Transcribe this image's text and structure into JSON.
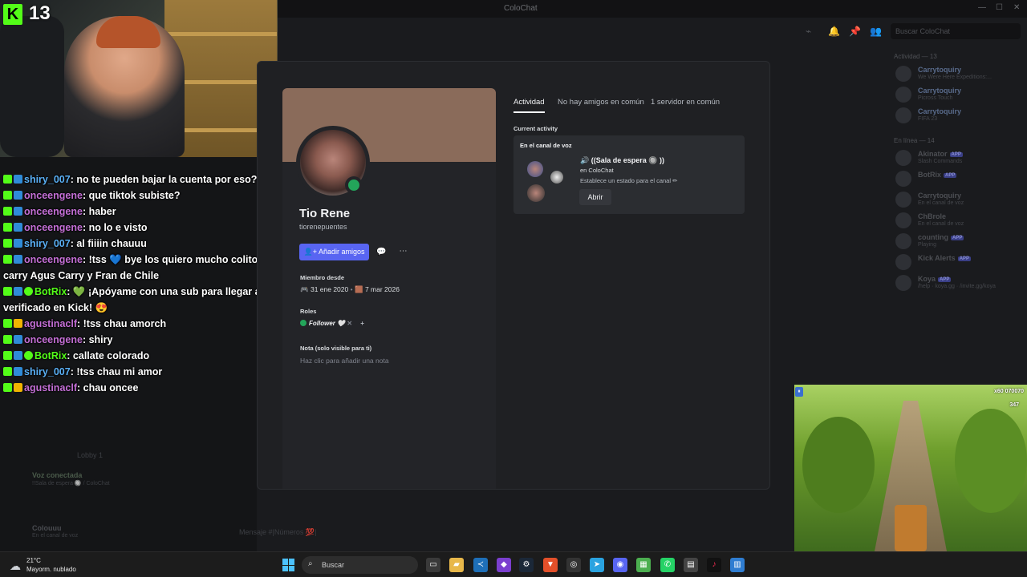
{
  "window": {
    "title": "ColoChat",
    "search_placeholder": "Buscar ColoChat"
  },
  "overlay": {
    "viewer_count": "13",
    "chat": [
      {
        "user": "shiry_007",
        "user_color": "#5ab0f6",
        "badges": [
          "k",
          "b"
        ],
        "text": ": no te pueden bajar la cuenta por eso?"
      },
      {
        "user": "onceengene",
        "user_color": "#c46fd6",
        "badges": [
          "k",
          "b"
        ],
        "text": ": que tiktok subiste?"
      },
      {
        "user": "onceengene",
        "user_color": "#c46fd6",
        "badges": [
          "k",
          "b"
        ],
        "text": ": haber"
      },
      {
        "user": "onceengene",
        "user_color": "#c46fd6",
        "badges": [
          "k",
          "b"
        ],
        "text": ": no lo e visto"
      },
      {
        "user": "shiry_007",
        "user_color": "#5ab0f6",
        "badges": [
          "k",
          "b"
        ],
        "text": ": al fiiiin chauuu"
      },
      {
        "user": "onceengene",
        "user_color": "#c46fd6",
        "badges": [
          "k",
          "b"
        ],
        "text": ": !tss 💙 bye los quiero mucho colito carry Agus Carry y Fran de Chile"
      },
      {
        "user": "BotRix",
        "user_color": "#53fc18",
        "badges": [
          "k",
          "b",
          "g"
        ],
        "text": ": 💚 ¡Apóyame con una sub para llegar al verificado en Kick! 😍"
      },
      {
        "user": "agustinaclf",
        "user_color": "#c46fd6",
        "badges": [
          "k",
          "c"
        ],
        "text": ": !tss chau amorch"
      },
      {
        "user": "onceengene",
        "user_color": "#c46fd6",
        "badges": [
          "k",
          "b"
        ],
        "text": ": shiry"
      },
      {
        "user": "BotRix",
        "user_color": "#53fc18",
        "badges": [
          "k",
          "b",
          "g"
        ],
        "text": ": callate colorado"
      },
      {
        "user": "shiry_007",
        "user_color": "#5ab0f6",
        "badges": [
          "k",
          "b"
        ],
        "text": ": !tss chau mi amor"
      },
      {
        "user": "agustinaclf",
        "user_color": "#c46fd6",
        "badges": [
          "k",
          "c"
        ],
        "text": ": chau oncee"
      }
    ]
  },
  "left_panel": {
    "voice_connected": "Voz conectada",
    "voice_channel": "!!Sala de espera 🔘 / ColoChat",
    "lobby": "Lobby 1",
    "user_name": "Colouuu",
    "user_status": "En el canal de voz",
    "message_placeholder": "Mensaje #|Números 💯|"
  },
  "profile": {
    "display_name": "Tio Rene",
    "username": "tiorenepuentes",
    "add_friends": "Añadir amigos",
    "member_since_label": "Miembro desde",
    "discord_since": "31 ene 2020",
    "server_since": "7 mar 2026",
    "roles_label": "Roles",
    "role_name": "Follower",
    "note_label": "Nota (solo visible para ti)",
    "note_placeholder": "Haz clic para añadir una nota",
    "banner_color": "#8a6b5a",
    "status_color": "#23a55a"
  },
  "tabs": [
    {
      "label": "Actividad",
      "active": true
    },
    {
      "label": "No hay amigos en común",
      "active": false
    },
    {
      "label": "1 servidor en común",
      "active": false
    }
  ],
  "activity": {
    "section_label": "Current activity",
    "card_header": "En el canal de voz",
    "channel_name": "🔊 ((Sala de espera 🔘 ))",
    "channel_server": "en ColoChat",
    "channel_status": "Establece un estado para el canal ✏",
    "open_button": "Abrir"
  },
  "members": {
    "activity_header": "Actividad — 13",
    "online_header": "En línea — 14",
    "activity_items": [
      {
        "name": "Carrytoquiry",
        "sub": "We Were Here Expeditions:..."
      },
      {
        "name": "Carrytoquiry",
        "sub": "Picross Touch"
      },
      {
        "name": "Carrytoquiry",
        "sub": "FIFA 23"
      }
    ],
    "online_items": [
      {
        "name": "Akinator",
        "sub": "Slash Commands",
        "app": true
      },
      {
        "name": "BotRix",
        "sub": "",
        "app": true
      },
      {
        "name": "Carrytoquiry",
        "sub": "En el canal de voz",
        "app": false
      },
      {
        "name": "ChBrole",
        "sub": "En el canal de voz",
        "app": false
      },
      {
        "name": "counting",
        "sub": "Playing",
        "app": true
      },
      {
        "name": "Kick Alerts",
        "sub": "",
        "app": true
      },
      {
        "name": "Koya",
        "sub": "/help · koya.gg · /invite.gg/koya",
        "app": true
      }
    ],
    "app_badge": "APP"
  },
  "game": {
    "score": "x60 070070",
    "coins": "347"
  },
  "taskbar": {
    "temperature": "21°C",
    "weather": "Mayorm. nublado",
    "search": "Buscar"
  }
}
